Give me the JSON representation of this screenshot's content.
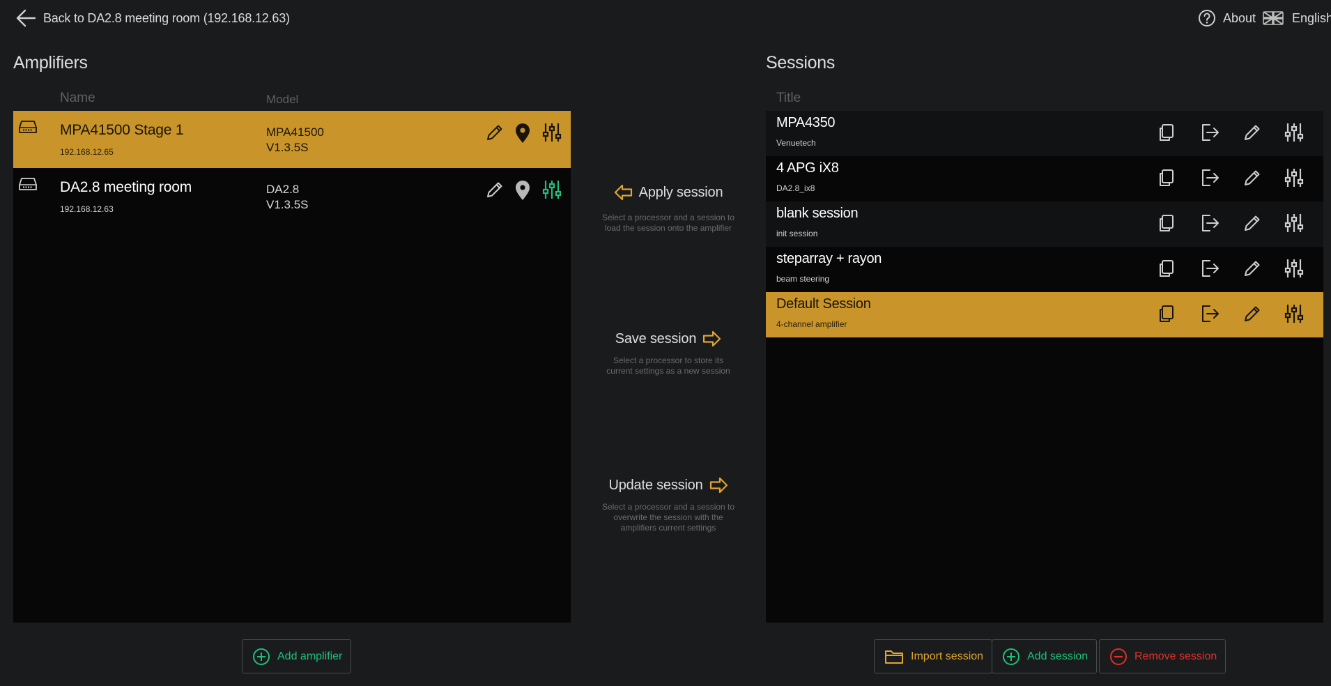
{
  "topbar": {
    "back_label": "Back to DA2.8 meeting room (192.168.12.63)",
    "about_label": "About",
    "language_label": "English"
  },
  "amplifiers": {
    "title": "Amplifiers",
    "col_name": "Name",
    "col_model": "Model",
    "rows": [
      {
        "name": "MPA41500 Stage 1",
        "ip": "192.168.12.65",
        "model": "MPA41500",
        "version": "V1.3.5S",
        "selected": true
      },
      {
        "name": "DA2.8 meeting room",
        "ip": "192.168.12.63",
        "model": "DA2.8",
        "version": "V1.3.5S",
        "selected": false
      }
    ],
    "add_label": "Add amplifier"
  },
  "middle": {
    "apply_label": "Apply session",
    "apply_hint": "Select a processor and a session to load the session onto the amplifier",
    "save_label": "Save session",
    "save_hint": "Select a processor to store its current settings as a new session",
    "update_label": "Update session",
    "update_hint": "Select a processor and a session to overwrite the session with the amplifiers current settings"
  },
  "sessions": {
    "title": "Sessions",
    "col_title": "Title",
    "rows": [
      {
        "title": "MPA4350",
        "subtitle": "Venuetech",
        "selected": false
      },
      {
        "title": "4 APG iX8",
        "subtitle": "DA2.8_ix8",
        "selected": false
      },
      {
        "title": "blank session",
        "subtitle": "init session",
        "selected": false
      },
      {
        "title": "steparray + rayon",
        "subtitle": "beam steering",
        "selected": false
      },
      {
        "title": "Default Session",
        "subtitle": "4-channel amplifier",
        "selected": true
      }
    ],
    "import_label": "Import session",
    "add_label": "Add session",
    "remove_label": "Remove session"
  },
  "colors": {
    "accent": "#c9952a",
    "green": "#21c07a",
    "red": "#e0302c",
    "background": "#1a1b1c",
    "panel": "#070708"
  },
  "icons": {
    "back": "arrow-left-icon",
    "about": "question-circle-icon",
    "language": "uk-flag-icon",
    "device": "amplifier-device-icon",
    "edit": "pencil-icon",
    "locate": "map-pin-icon",
    "settings": "sliders-icon",
    "copy": "copy-icon",
    "export": "export-icon",
    "apply": "arrow-left-outline-icon",
    "save": "arrow-right-outline-icon",
    "import": "folder-icon",
    "add": "plus-circle-icon",
    "remove": "minus-circle-icon"
  }
}
